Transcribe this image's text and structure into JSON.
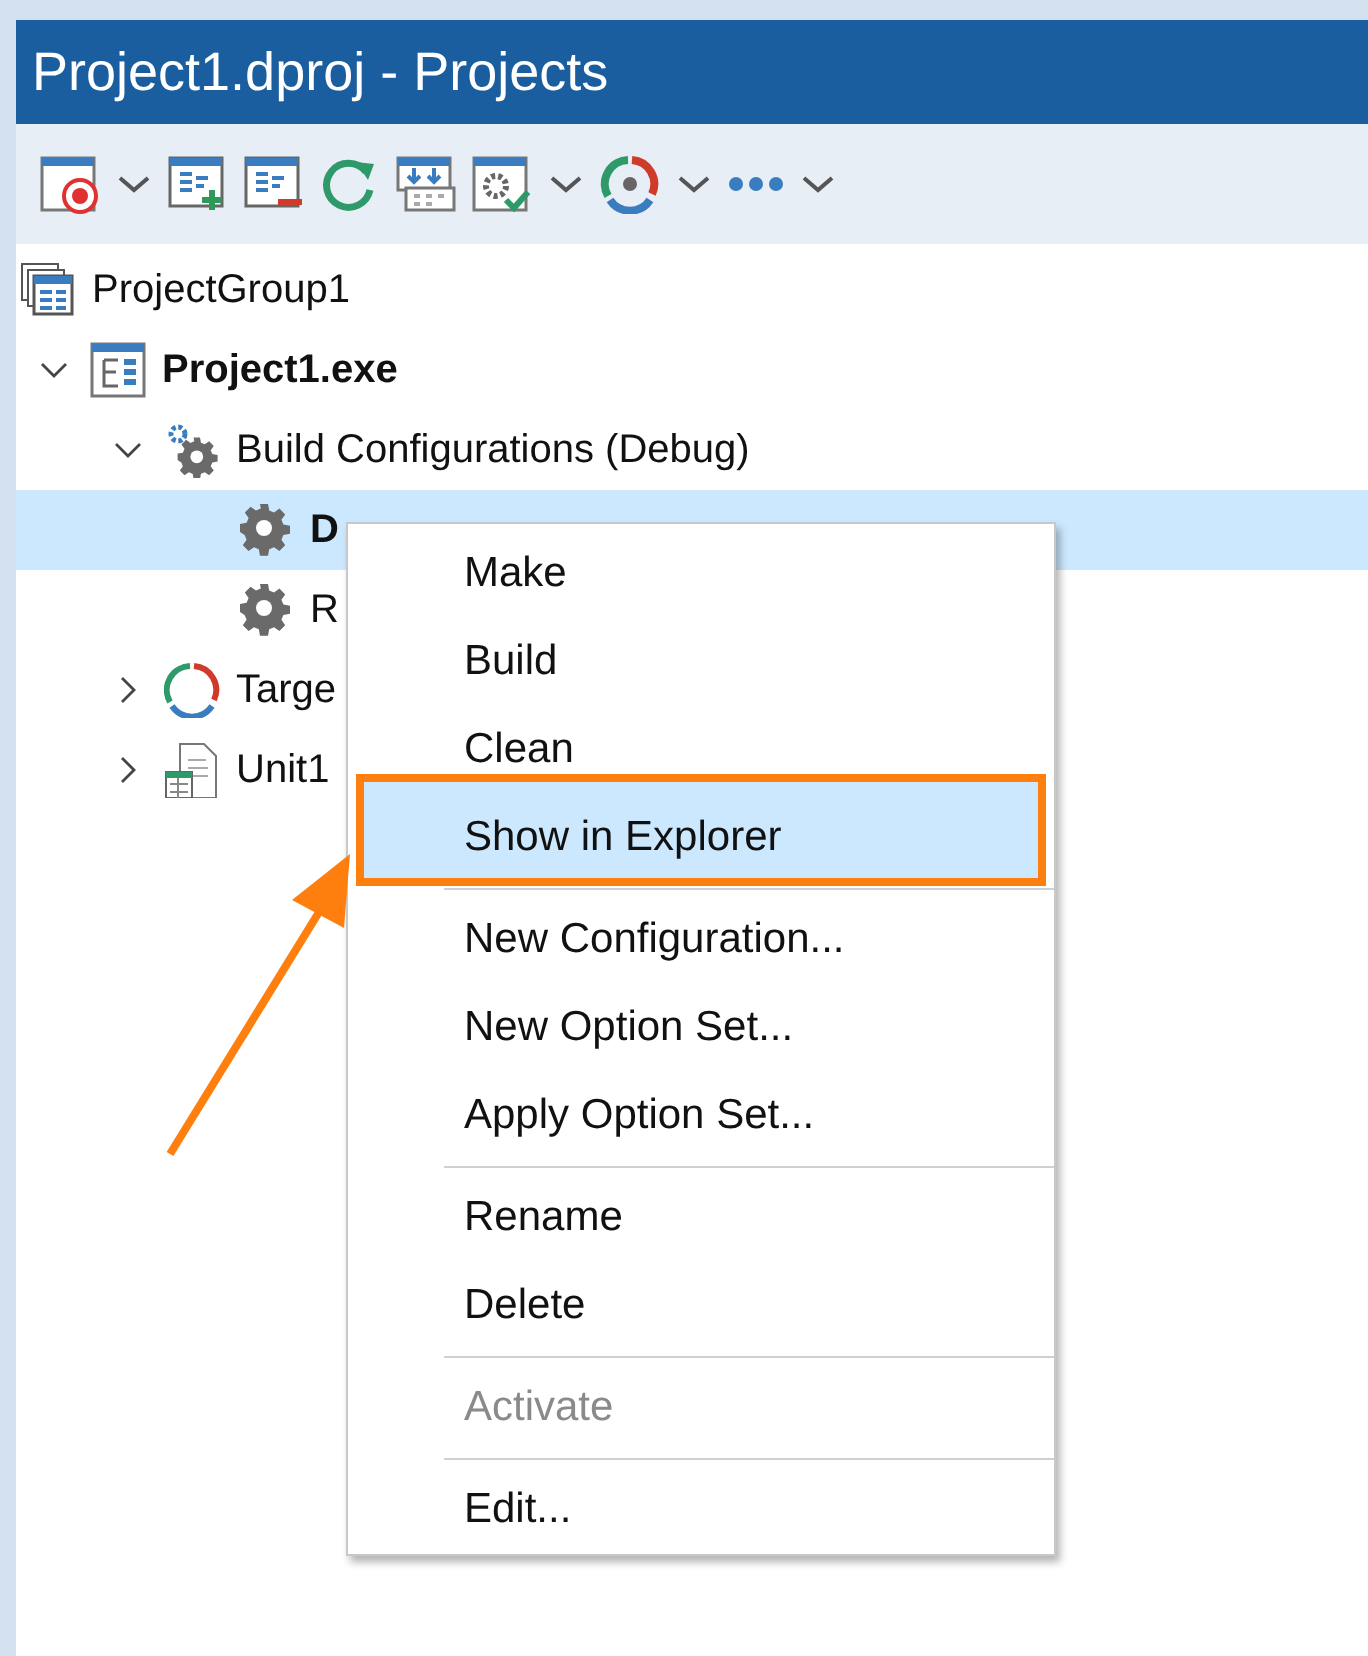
{
  "window": {
    "title": "Project1.dproj - Projects"
  },
  "toolbar": [
    {
      "kind": "activate",
      "dropdown": true
    },
    {
      "kind": "add",
      "dropdown": false
    },
    {
      "kind": "remove",
      "dropdown": false
    },
    {
      "kind": "refresh",
      "dropdown": false
    },
    {
      "kind": "deploy",
      "dropdown": false
    },
    {
      "kind": "options",
      "dropdown": true
    },
    {
      "kind": "platform",
      "dropdown": true
    },
    {
      "kind": "more",
      "dropdown": true
    }
  ],
  "tree": {
    "label": "ProjectGroup1",
    "kind": "group",
    "active": false,
    "selected": false,
    "children": [
      {
        "label": "Project1.exe",
        "kind": "project",
        "active": true,
        "selected": false,
        "expanded": true,
        "children": [
          {
            "label": "Build Configurations (Debug)",
            "kind": "configs",
            "active": false,
            "selected": false,
            "expanded": true,
            "children": [
              {
                "label": "D",
                "kind": "config",
                "active": true,
                "selected": true
              },
              {
                "label": "R",
                "kind": "config",
                "active": false,
                "selected": false
              }
            ]
          },
          {
            "label": "Targe",
            "kind": "targets",
            "active": false,
            "selected": false,
            "expanded": false
          },
          {
            "label": "Unit1",
            "kind": "unit",
            "active": false,
            "selected": false,
            "expanded": false
          }
        ]
      }
    ]
  },
  "context_menu": {
    "items": [
      {
        "kind": "item",
        "label": "Make",
        "selected": false,
        "disabled": false,
        "outlined": false
      },
      {
        "kind": "item",
        "label": "Build",
        "selected": false,
        "disabled": false,
        "outlined": false
      },
      {
        "kind": "item",
        "label": "Clean",
        "selected": false,
        "disabled": false,
        "outlined": false
      },
      {
        "kind": "item",
        "label": "Show in Explorer",
        "selected": true,
        "disabled": false,
        "outlined": true
      },
      {
        "kind": "separator"
      },
      {
        "kind": "item",
        "label": "New Configuration...",
        "selected": false,
        "disabled": false,
        "outlined": false
      },
      {
        "kind": "item",
        "label": "New Option Set...",
        "selected": false,
        "disabled": false,
        "outlined": false
      },
      {
        "kind": "item",
        "label": "Apply Option Set...",
        "selected": false,
        "disabled": false,
        "outlined": false
      },
      {
        "kind": "separator"
      },
      {
        "kind": "item",
        "label": "Rename",
        "selected": false,
        "disabled": false,
        "outlined": false
      },
      {
        "kind": "item",
        "label": "Delete",
        "selected": false,
        "disabled": false,
        "outlined": false
      },
      {
        "kind": "separator"
      },
      {
        "kind": "item",
        "label": "Activate",
        "selected": false,
        "disabled": true,
        "outlined": false
      },
      {
        "kind": "separator"
      },
      {
        "kind": "item",
        "label": "Edit...",
        "selected": false,
        "disabled": false,
        "outlined": false
      }
    ]
  }
}
